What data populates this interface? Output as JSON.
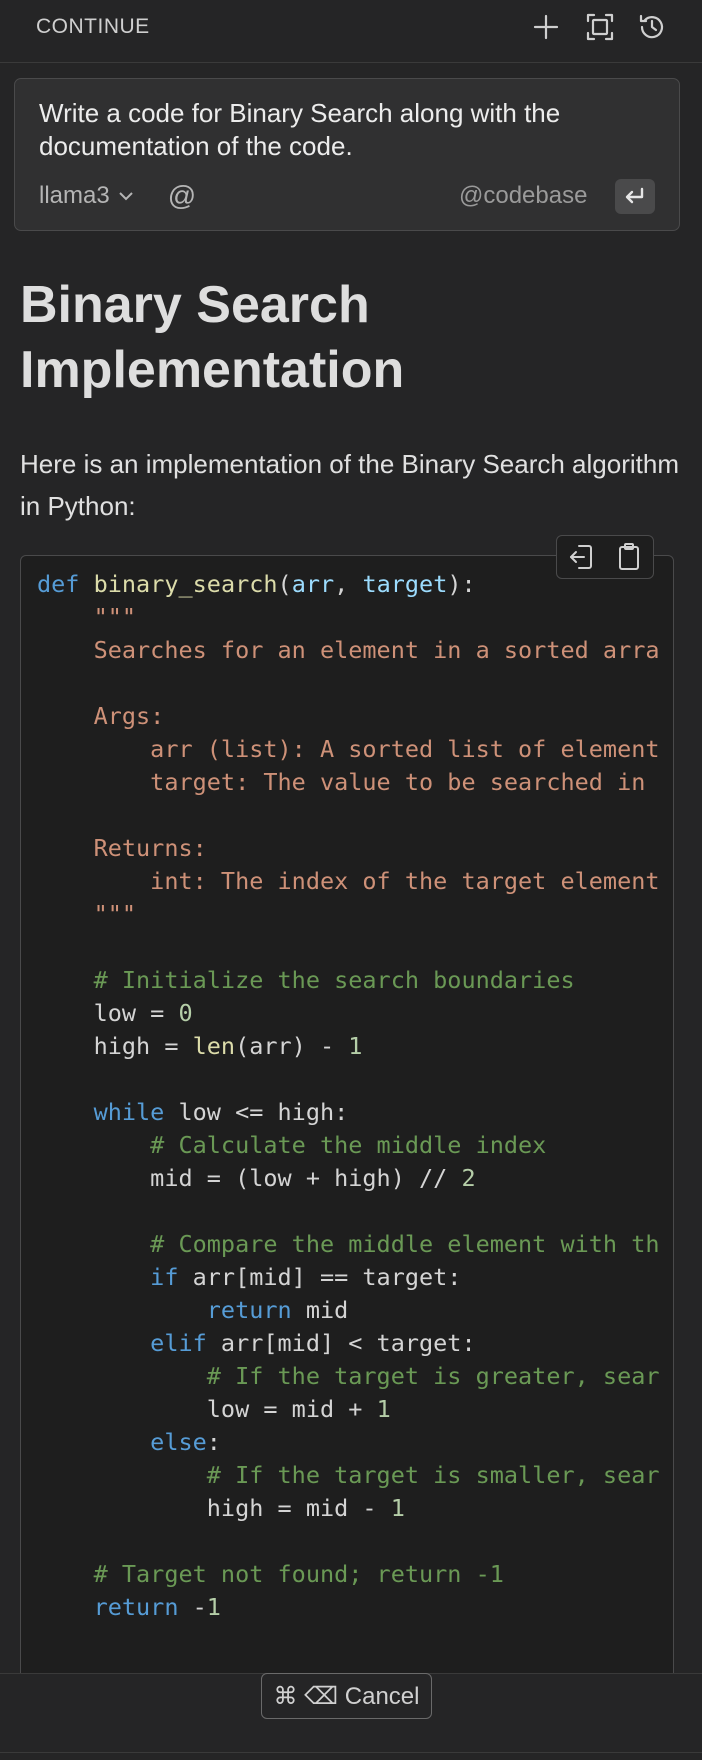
{
  "header": {
    "title": "CONTINUE"
  },
  "input": {
    "prompt": "Write a code for Binary Search along with the documentation of the code.",
    "model": "llama3",
    "at_symbol": "@",
    "codebase_label": "@codebase"
  },
  "response": {
    "heading": "Binary Search Implementation",
    "intro": "Here is an implementation of the Binary Search algorithm in Python:"
  },
  "code": {
    "language": "python",
    "lines": [
      [
        [
          "kw",
          "def"
        ],
        [
          "",
          " "
        ],
        [
          "fn",
          "binary_search"
        ],
        [
          "",
          "("
        ],
        [
          "pm",
          "arr"
        ],
        [
          "",
          ", "
        ],
        [
          "pm",
          "target"
        ],
        [
          "",
          "):"
        ]
      ],
      [
        [
          "str",
          "    \"\"\""
        ]
      ],
      [
        [
          "str",
          "    Searches for an element in a sorted arra"
        ]
      ],
      [
        [
          "",
          ""
        ]
      ],
      [
        [
          "str",
          "    Args:"
        ]
      ],
      [
        [
          "str",
          "        arr (list): A sorted list of element"
        ]
      ],
      [
        [
          "str",
          "        target: The value to be searched in "
        ]
      ],
      [
        [
          "",
          ""
        ]
      ],
      [
        [
          "str",
          "    Returns:"
        ]
      ],
      [
        [
          "str",
          "        int: The index of the target element"
        ]
      ],
      [
        [
          "str",
          "    \"\"\""
        ]
      ],
      [
        [
          "",
          ""
        ]
      ],
      [
        [
          "cm",
          "    # Initialize the search boundaries"
        ]
      ],
      [
        [
          "",
          "    low = "
        ],
        [
          "num",
          "0"
        ]
      ],
      [
        [
          "",
          "    high = "
        ],
        [
          "fn",
          "len"
        ],
        [
          "",
          "(arr) - "
        ],
        [
          "num",
          "1"
        ]
      ],
      [
        [
          "",
          ""
        ]
      ],
      [
        [
          "kw",
          "    while"
        ],
        [
          "",
          " low <= high:"
        ]
      ],
      [
        [
          "cm",
          "        # Calculate the middle index"
        ]
      ],
      [
        [
          "",
          "        mid = (low + high) // "
        ],
        [
          "num",
          "2"
        ]
      ],
      [
        [
          "",
          ""
        ]
      ],
      [
        [
          "cm",
          "        # Compare the middle element with th"
        ]
      ],
      [
        [
          "kw",
          "        if"
        ],
        [
          "",
          " arr[mid] == target:"
        ]
      ],
      [
        [
          "kw",
          "            return"
        ],
        [
          "",
          " mid"
        ]
      ],
      [
        [
          "kw",
          "        elif"
        ],
        [
          "",
          " arr[mid] < target:"
        ]
      ],
      [
        [
          "cm",
          "            # If the target is greater, sear"
        ]
      ],
      [
        [
          "",
          "            low = mid + "
        ],
        [
          "num",
          "1"
        ]
      ],
      [
        [
          "kw",
          "        else"
        ],
        [
          "",
          ":"
        ]
      ],
      [
        [
          "cm",
          "            # If the target is smaller, sear"
        ]
      ],
      [
        [
          "",
          "            high = mid - "
        ],
        [
          "num",
          "1"
        ]
      ],
      [
        [
          "",
          ""
        ]
      ],
      [
        [
          "cm",
          "    # Target not found; return -1"
        ]
      ],
      [
        [
          "kw",
          "    return"
        ],
        [
          "",
          " -"
        ],
        [
          "num",
          "1"
        ]
      ]
    ]
  },
  "cancel": {
    "label": "⌘ ⌫ Cancel"
  },
  "colors": {
    "background": "#252526",
    "code_background": "#1e1e1e",
    "keyword": "#569cd6",
    "function": "#dcdcaa",
    "string": "#ce9178",
    "comment": "#6a9955"
  },
  "icons": {
    "new": "plus-icon",
    "fullscreen": "fullscreen-icon",
    "history": "history-icon",
    "chevron": "chevron-down-icon",
    "enter": "enter-icon",
    "insert": "insert-at-cursor-icon",
    "copy": "clipboard-icon"
  }
}
